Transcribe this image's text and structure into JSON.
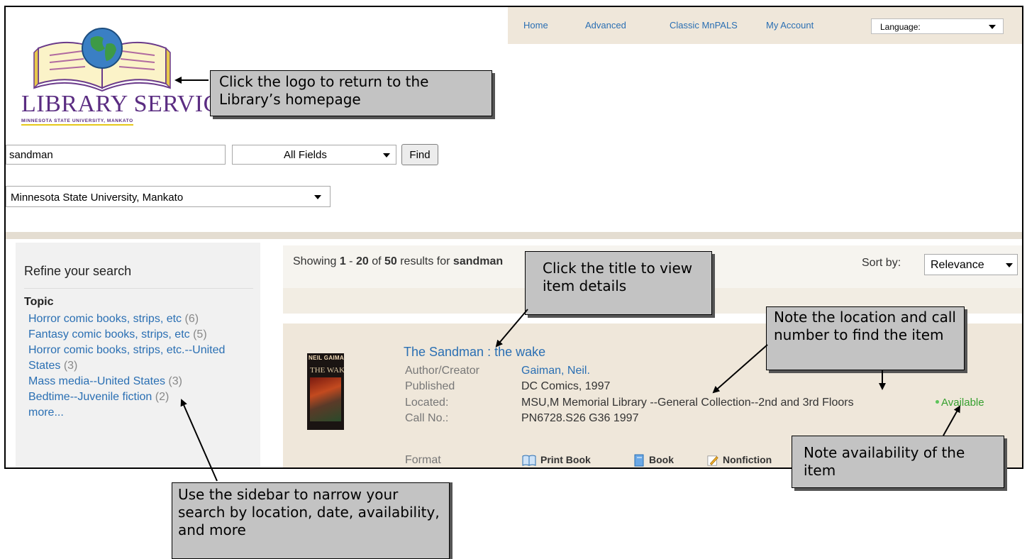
{
  "topnav": {
    "links": [
      "Home",
      "Advanced",
      "Classic MnPALS",
      "My Account"
    ],
    "language_label": "Language:"
  },
  "logo": {
    "title": "LIBRARY SERVICES",
    "subtitle": "MINNESOTA STATE UNIVERSITY, MANKATO"
  },
  "search": {
    "query": "sandman",
    "field": "All Fields",
    "button": "Find",
    "library": "Minnesota State University, Mankato"
  },
  "sidebar": {
    "title": "Refine your search",
    "section": "Topic",
    "facets": [
      {
        "label": "Horror comic books, strips, etc",
        "count": "(6)"
      },
      {
        "label": "Fantasy comic books, strips, etc",
        "count": "(5)"
      },
      {
        "label": "Horror comic books, strips, etc.--United States",
        "count": "(3)"
      },
      {
        "label": "Mass media--United States",
        "count": "(3)"
      },
      {
        "label": "Bedtime--Juvenile fiction",
        "count": "(2)"
      }
    ],
    "more": "more..."
  },
  "results": {
    "showing_prefix": "Showing ",
    "range_start": "1",
    "range_sep": " - ",
    "range_end": "20",
    "of": " of ",
    "total": "50",
    "for": " results for ",
    "query": "sandman",
    "sort_label": "Sort by:",
    "sort_value": "Relevance"
  },
  "record": {
    "title": "The Sandman : the wake",
    "cover": {
      "author": "NEIL GAIMAN",
      "title": "THE WAKE"
    },
    "fields": [
      {
        "label": "Author/Creator",
        "value": "Gaiman, Neil."
      },
      {
        "label": "Published",
        "value": "DC Comics, 1997"
      },
      {
        "label": "Located:",
        "value": "MSU,M Memorial Library --General Collection--2nd and 3rd Floors"
      },
      {
        "label": "Call No.:",
        "value": "PN6728.S26 G36 1997"
      }
    ],
    "availability": "Available",
    "format_label": "Format",
    "formats": [
      "Print Book",
      "Book",
      "Nonfiction"
    ]
  },
  "callouts": {
    "logo": "Click the logo to return to the Library’s homepage",
    "title": "Click the title to view item details",
    "location": "Note the location and call number to find the item",
    "availability": "Note availability of the item",
    "sidebar": "Use the sidebar to narrow your search by location, date, availability, and more"
  },
  "colors": {
    "link": "#2a6fb3",
    "available": "#36a02f",
    "nav_bg": "#efe7da",
    "callout_bg": "#c3c3c3",
    "logo_purple": "#5b2d82"
  }
}
